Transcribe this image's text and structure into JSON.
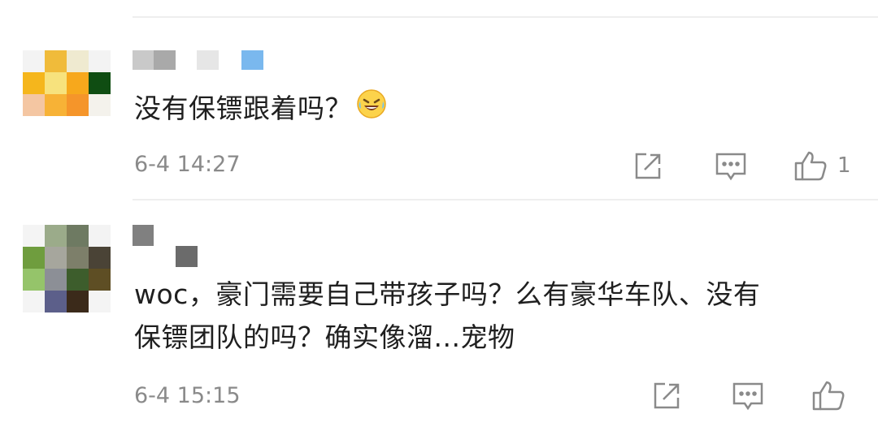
{
  "comments": [
    {
      "text": "没有保镖跟着吗？",
      "emoji": "laughing-crying-emoji",
      "timestamp": "6-4 14:27",
      "likes": "1",
      "avatar_colors": [
        "#f3f3f3",
        "#f0bb3a",
        "#efead0",
        "#f3f3f3",
        "#f5b61c",
        "#f7e27d",
        "#f7a81c",
        "#0f4d12",
        "#f4c6a2",
        "#f7b236",
        "#f5952a",
        "#f4f2ec"
      ],
      "name_colors": [
        "#c9c9c9",
        "#a9a9a9",
        "#e6e6e6",
        "#7ab8ee"
      ]
    },
    {
      "text_line1": "woc，豪门需要自己带孩子吗？么有豪华车队、没有",
      "text_line2": "保镖团队的吗？确实像溜...宠物",
      "timestamp": "6-4 15:15",
      "avatar_colors": [
        "#f4f4f4",
        "#9bab8a",
        "#6e7a62",
        "#f3f3f3",
        "#6f9d3e",
        "#a6a69d",
        "#7d7f6a",
        "#4a4336",
        "#95c46a",
        "#8c8f96",
        "#3d5d2c",
        "#5e4e24",
        "#f4f4f4",
        "#5c5f8a",
        "#3b2a1a",
        "#f4f4f4"
      ],
      "name_colors": [
        "#808080",
        "#6b6b6b"
      ]
    }
  ],
  "icons": {
    "share": "share-icon",
    "reply": "comment-icon",
    "like": "thumbs-up-icon"
  }
}
